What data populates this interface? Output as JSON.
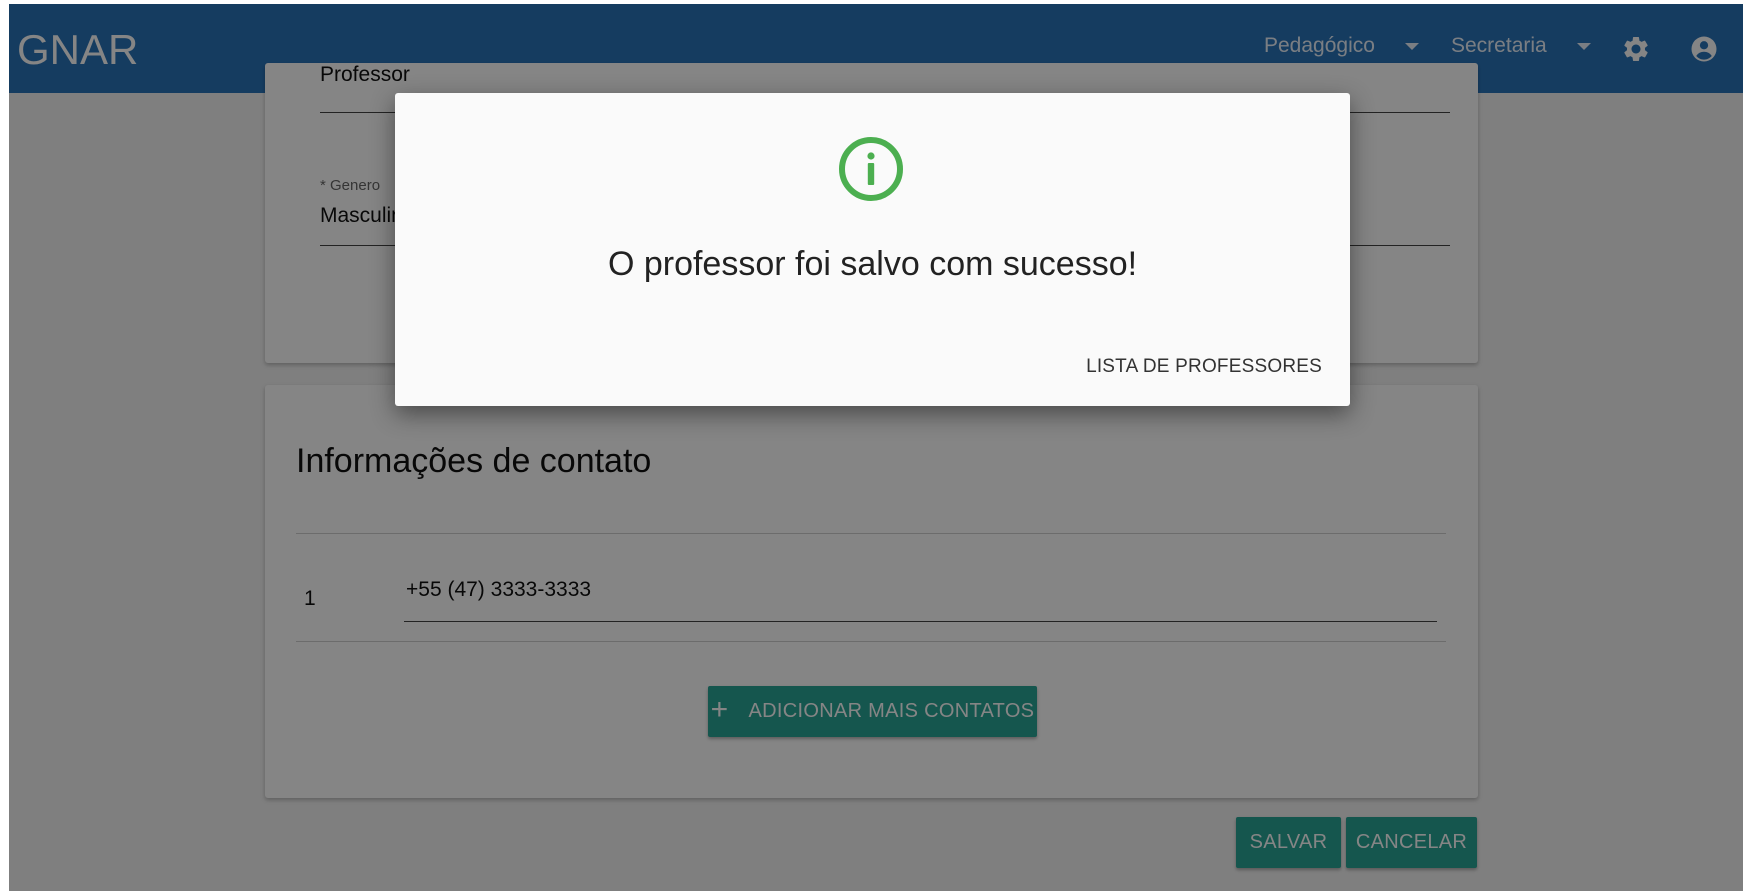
{
  "header": {
    "brand": "GNAR",
    "menus": [
      {
        "label": "Pedagógico"
      },
      {
        "label": "Secretaria"
      }
    ],
    "icons": [
      "gear-icon",
      "account-circle-icon"
    ]
  },
  "form": {
    "name_partial": "Professor",
    "gender_label": "* Genero",
    "gender_value": "Masculino"
  },
  "contacts": {
    "title": "Informações de contato",
    "items": [
      {
        "index": "1",
        "value": "+55 (47) 3333-3333"
      }
    ],
    "add_button": "ADICIONAR MAIS CONTATOS"
  },
  "actions": {
    "save": "SALVAR",
    "cancel": "CANCELAR"
  },
  "dialog": {
    "icon": "info-circle-icon",
    "icon_color": "#4caf50",
    "message": "O professor foi salvo com sucesso!",
    "action": "LISTA DE PROFESSORES"
  },
  "colors": {
    "header": "#2a74b9",
    "accent": "#2aa596"
  }
}
